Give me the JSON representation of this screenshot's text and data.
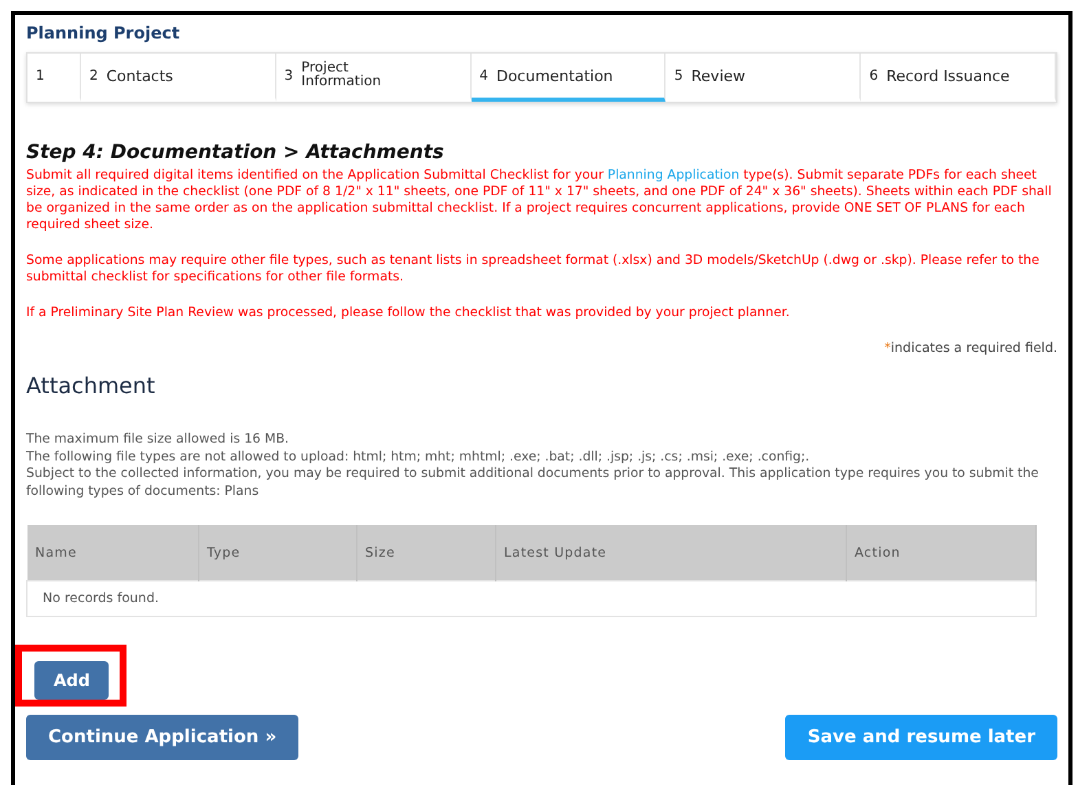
{
  "title": "Planning Project",
  "tabs": [
    {
      "number": "1",
      "selected": false
    },
    {
      "number": "2",
      "label": "Contacts",
      "selected": false
    },
    {
      "number": "3",
      "label": "Project Information",
      "selected": false
    },
    {
      "number": "4",
      "label": "Documentation",
      "selected": true
    },
    {
      "number": "5",
      "label": "Review",
      "selected": false
    },
    {
      "number": "6",
      "label": "Record Issuance",
      "selected": false
    }
  ],
  "step_heading": "Step 4: Documentation > Attachments",
  "instructions": {
    "before_link": "Submit all required digital items identified on the Application Submittal Checklist for your",
    "link": "Planning Application",
    "after_link": "type(s).  Submit separate PDFs for each sheet size, as indicated in the checklist (one PDF of 8 1/2\" x 11\" sheets, one PDF of 11\" x 17\" sheets, and one PDF of 24\" x 36\" sheets).  Sheets within each PDF shall be organized in the same order as on the application submittal checklist.  If a project requires concurrent applications, provide ONE SET OF PLANS for each required sheet size."
  },
  "notes": [
    "Some applications may require other file types, such as tenant lists in spreadsheet format (.xlsx) and 3D models/SketchUp (.dwg or .skp). Please refer to the submittal checklist for specifications for other file formats.",
    "If a Preliminary Site Plan Review was processed, please follow the checklist that was provided by your project planner."
  ],
  "required_note": {
    "mark": "*",
    "text": "indicates a required field."
  },
  "section_title": "Attachment",
  "info_lines": [
    "The maximum file size allowed is 16 MB.",
    "The following file types are not allowed to upload: html; htm; mht; mhtml; .exe; .bat; .dll; .jsp; .js; .cs; .msi; .exe; .config;.",
    "Subject to the collected information, you may be required to submit additional documents prior to approval. This application type requires you to submit the following types of documents: Plans"
  ],
  "table": {
    "columns": [
      "Name",
      "Type",
      "Size",
      "Latest Update",
      "Action"
    ],
    "empty_message": "No records found."
  },
  "add_button": {
    "label": "Add",
    "highlighted": true
  },
  "continue_button": "Continue Application »",
  "save_button": "Save and resume later"
}
